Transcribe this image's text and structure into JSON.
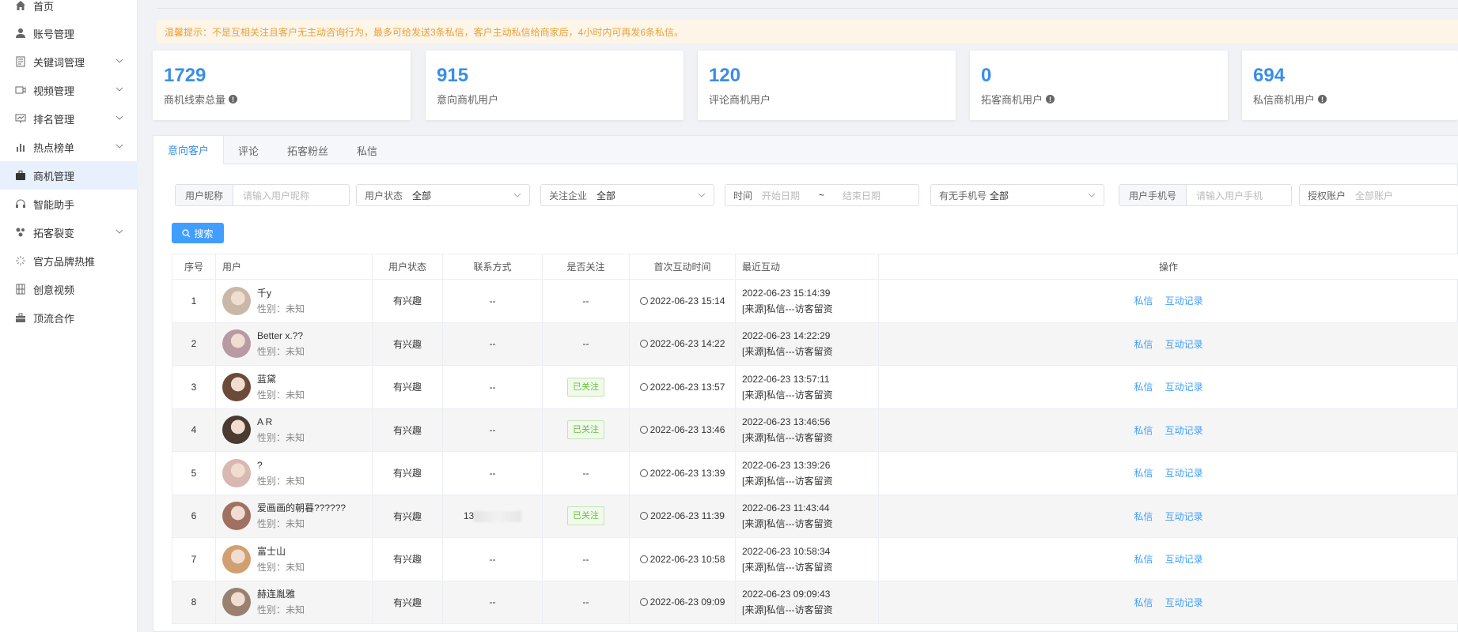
{
  "sidebar": {
    "items": [
      {
        "label": "首页",
        "icon": "home-icon",
        "chevron": false
      },
      {
        "label": "账号管理",
        "icon": "user-icon",
        "chevron": false
      },
      {
        "label": "关键词管理",
        "icon": "document-icon",
        "chevron": true
      },
      {
        "label": "视频管理",
        "icon": "video-icon",
        "chevron": true
      },
      {
        "label": "排名管理",
        "icon": "ranking-icon",
        "chevron": true
      },
      {
        "label": "热点榜单",
        "icon": "bar-chart-icon",
        "chevron": true
      },
      {
        "label": "商机管理",
        "icon": "briefcase-icon",
        "chevron": false,
        "active": true
      },
      {
        "label": "智能助手",
        "icon": "headset-icon",
        "chevron": false
      },
      {
        "label": "拓客裂变",
        "icon": "fission-icon",
        "chevron": true
      },
      {
        "label": "官方品牌热推",
        "icon": "spark-icon",
        "chevron": false
      },
      {
        "label": "创意视频",
        "icon": "film-icon",
        "chevron": false
      },
      {
        "label": "顶流合作",
        "icon": "suitcase-icon",
        "chevron": false
      }
    ]
  },
  "notice": "温馨提示：不是互相关注且客户无主动咨询行为，最多可给发送3条私信，客户主动私信给商家后，4小时内可再发6条私信。",
  "stats": [
    {
      "value": "1729",
      "label": "商机线索总量",
      "info": true
    },
    {
      "value": "915",
      "label": "意向商机用户",
      "info": false
    },
    {
      "value": "120",
      "label": "评论商机用户",
      "info": false
    },
    {
      "value": "0",
      "label": "拓客商机用户",
      "info": true
    },
    {
      "value": "694",
      "label": "私信商机用户",
      "info": true
    }
  ],
  "tabs": [
    "意向客户",
    "评论",
    "拓客粉丝",
    "私信"
  ],
  "filters": {
    "nickname": {
      "prefix": "用户昵称",
      "placeholder": "请输入用户昵称"
    },
    "status": {
      "label": "用户状态",
      "value": "全部"
    },
    "company": {
      "label": "关注企业",
      "value": "全部"
    },
    "time": {
      "label": "时间",
      "start": "开始日期",
      "sep": "~",
      "end": "结束日期"
    },
    "phone_has": {
      "label": "有无手机号",
      "value": "全部"
    },
    "phone": {
      "prefix": "用户手机号",
      "placeholder": "请输入用户手机"
    },
    "account": {
      "label": "授权账户",
      "value": "全部账户"
    }
  },
  "search_label": "搜索",
  "table": {
    "headers": [
      "序号",
      "用户",
      "用户状态",
      "联系方式",
      "是否关注",
      "首次互动时间",
      "最近互动",
      "操作"
    ],
    "op_links": [
      "私信",
      "互动记录"
    ],
    "rows": [
      {
        "no": "1",
        "name": "千y",
        "gender": "性别：未知",
        "status": "有兴趣",
        "contact": "--",
        "follow": "--",
        "first": "2022-06-23 15:14",
        "recent_time": "2022-06-23 15:14:39",
        "recent_src": "[来源]私信---访客留资"
      },
      {
        "no": "2",
        "name": "Better x.??",
        "gender": "性别：未知",
        "status": "有兴趣",
        "contact": "--",
        "follow": "--",
        "first": "2022-06-23 14:22",
        "recent_time": "2022-06-23 14:22:29",
        "recent_src": "[来源]私信---访客留资"
      },
      {
        "no": "3",
        "name": "蓝黛",
        "gender": "性别：未知",
        "status": "有兴趣",
        "contact": "--",
        "follow": "已关注",
        "first": "2022-06-23 13:57",
        "recent_time": "2022-06-23 13:57:11",
        "recent_src": "[来源]私信---访客留资"
      },
      {
        "no": "4",
        "name": "A R",
        "gender": "性别：未知",
        "status": "有兴趣",
        "contact": "--",
        "follow": "已关注",
        "first": "2022-06-23 13:46",
        "recent_time": "2022-06-23 13:46:56",
        "recent_src": "[来源]私信---访客留资"
      },
      {
        "no": "5",
        "name": "?",
        "gender": "性别：未知",
        "status": "有兴趣",
        "contact": "--",
        "follow": "--",
        "first": "2022-06-23 13:39",
        "recent_time": "2022-06-23 13:39:26",
        "recent_src": "[来源]私信---访客留资"
      },
      {
        "no": "6",
        "name": "爱画画的朝暮??????",
        "gender": "性别：未知",
        "status": "有兴趣",
        "contact": "13",
        "follow": "已关注",
        "first": "2022-06-23 11:39",
        "recent_time": "2022-06-23 11:43:44",
        "recent_src": "[来源]私信---访客留资"
      },
      {
        "no": "7",
        "name": "富士山",
        "gender": "性别：未知",
        "status": "有兴趣",
        "contact": "--",
        "follow": "--",
        "first": "2022-06-23 10:58",
        "recent_time": "2022-06-23 10:58:34",
        "recent_src": "[来源]私信---访客留资"
      },
      {
        "no": "8",
        "name": "赫连胤雅",
        "gender": "性别：未知",
        "status": "有兴趣",
        "contact": "--",
        "follow": "--",
        "first": "2022-06-23 09:09",
        "recent_time": "2022-06-23 09:09:43",
        "recent_src": "[来源]私信---访客留资"
      }
    ]
  },
  "colors": {
    "accent": "#409eff",
    "stat_number": "#3a8ee6",
    "notice_text": "#e6a23c",
    "follow_tag": "#67c23a"
  }
}
